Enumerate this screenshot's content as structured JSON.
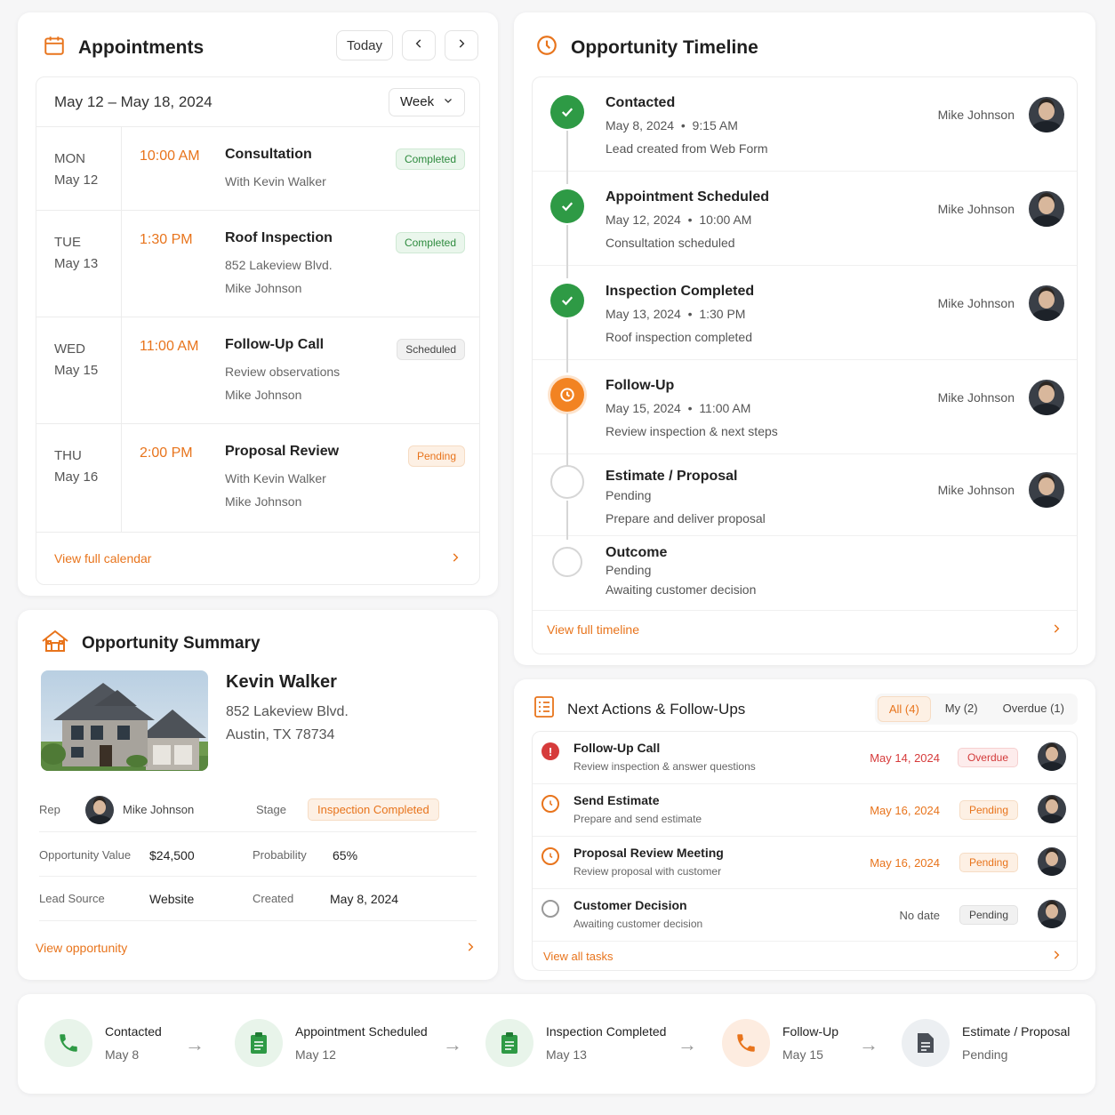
{
  "colors": {
    "accent": "#e8741c",
    "success": "#2e9a45",
    "danger": "#d63b3b"
  },
  "appointments": {
    "title": "Appointments",
    "today_label": "Today",
    "week_range": "May 12 – May 18, 2024",
    "view_select": "Week",
    "items": [
      {
        "dow": "MON",
        "date": "May 12",
        "time": "10:00 AM",
        "title": "Consultation",
        "line1": "With Kevin Walker",
        "line2": "",
        "status": "Completed"
      },
      {
        "dow": "TUE",
        "date": "May 13",
        "time": "1:30 PM",
        "title": "Roof Inspection",
        "line1": "852 Lakeview Blvd.",
        "line2": "Mike Johnson",
        "status": "Completed"
      },
      {
        "dow": "WED",
        "date": "May 15",
        "time": "11:00 AM",
        "title": "Follow-Up Call",
        "line1": "Review observations",
        "line2": "Mike Johnson",
        "status": "Scheduled"
      },
      {
        "dow": "THU",
        "date": "May 16",
        "time": "2:00 PM",
        "title": "Proposal Review",
        "line1": "With Kevin Walker",
        "line2": "Mike Johnson",
        "status": "Pending"
      }
    ],
    "view_link": "View full calendar"
  },
  "timeline": {
    "title": "Opportunity Timeline",
    "items": [
      {
        "title": "Contacted",
        "date": "May 8, 2024",
        "time": "9:15 AM",
        "note": "Lead created from Web Form",
        "user": "Mike Johnson",
        "state": "done"
      },
      {
        "title": "Appointment Scheduled",
        "date": "May 12, 2024",
        "time": "10:00 AM",
        "note": "Consultation scheduled",
        "user": "Mike Johnson",
        "state": "done"
      },
      {
        "title": "Inspection Completed",
        "date": "May 13, 2024",
        "time": "1:30 PM",
        "note": "Roof inspection completed",
        "user": "Mike Johnson",
        "state": "done"
      },
      {
        "title": "Follow-Up",
        "date": "May 15, 2024",
        "time": "11:00 AM",
        "note": "Review inspection & next steps",
        "user": "Mike Johnson",
        "state": "current"
      },
      {
        "title": "Estimate / Proposal",
        "status": "Pending",
        "note": "Prepare and deliver proposal",
        "user": "Mike Johnson",
        "state": "pending"
      },
      {
        "title": "Outcome",
        "status": "Pending",
        "note": "Awaiting customer decision",
        "user": "",
        "state": "pending"
      }
    ],
    "view_link": "View full timeline"
  },
  "summary": {
    "title": "Opportunity Summary",
    "customer_name": "Kevin Walker",
    "address_line1": "852 Lakeview Blvd.",
    "address_line2": "Austin, TX 78734",
    "rep_label": "Rep",
    "rep_name": "Mike Johnson",
    "stage_label": "Stage",
    "stage_value": "Inspection Completed",
    "value_label": "Opportunity Value",
    "value": "$24,500",
    "prob_label": "Probability",
    "prob_value": "65%",
    "source_label": "Lead Source",
    "source_value": "Website",
    "created_label": "Created",
    "created_value": "May 8, 2024",
    "view_link": "View opportunity"
  },
  "actions": {
    "title": "Next Actions & Follow-Ups",
    "tabs": [
      "All (4)",
      "My (2)",
      "Overdue (1)"
    ],
    "items": [
      {
        "title": "Follow-Up Call",
        "sub": "Review inspection & answer questions",
        "date": "May 14, 2024",
        "status": "Overdue",
        "icon": "alert-icon"
      },
      {
        "title": "Send Estimate",
        "sub": "Prepare and send estimate",
        "date": "May 16, 2024",
        "status": "Pending",
        "icon": "clock-icon"
      },
      {
        "title": "Proposal Review Meeting",
        "sub": "Review proposal with customer",
        "date": "May 16, 2024",
        "status": "Pending",
        "icon": "clock-icon"
      },
      {
        "title": "Customer Decision",
        "sub": "Awaiting customer decision",
        "date": "No date",
        "status": "Pending",
        "icon": "empty-circle-icon"
      }
    ],
    "view_link": "View all tasks"
  },
  "progress": {
    "steps": [
      {
        "title": "Contacted",
        "sub": "May 8",
        "icon": "phone-icon"
      },
      {
        "title": "Appointment Scheduled",
        "sub": "May 12",
        "icon": "clipboard-icon"
      },
      {
        "title": "Inspection Completed",
        "sub": "May 13",
        "icon": "clipboard-icon"
      },
      {
        "title": "Follow-Up",
        "sub": "May 15",
        "icon": "phone-icon"
      },
      {
        "title": "Estimate / Proposal",
        "sub": "Pending",
        "icon": "document-icon"
      }
    ]
  }
}
